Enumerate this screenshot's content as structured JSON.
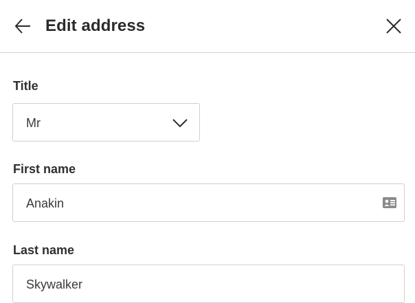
{
  "header": {
    "title": "Edit address",
    "back_icon": "arrow-left-icon",
    "close_icon": "close-icon"
  },
  "form": {
    "title_field": {
      "label": "Title",
      "value": "Mr",
      "icon": "chevron-down-icon"
    },
    "first_name": {
      "label": "First name",
      "value": "Anakin",
      "icon": "contact-card-icon"
    },
    "last_name": {
      "label": "Last name",
      "value": "Skywalker"
    }
  }
}
